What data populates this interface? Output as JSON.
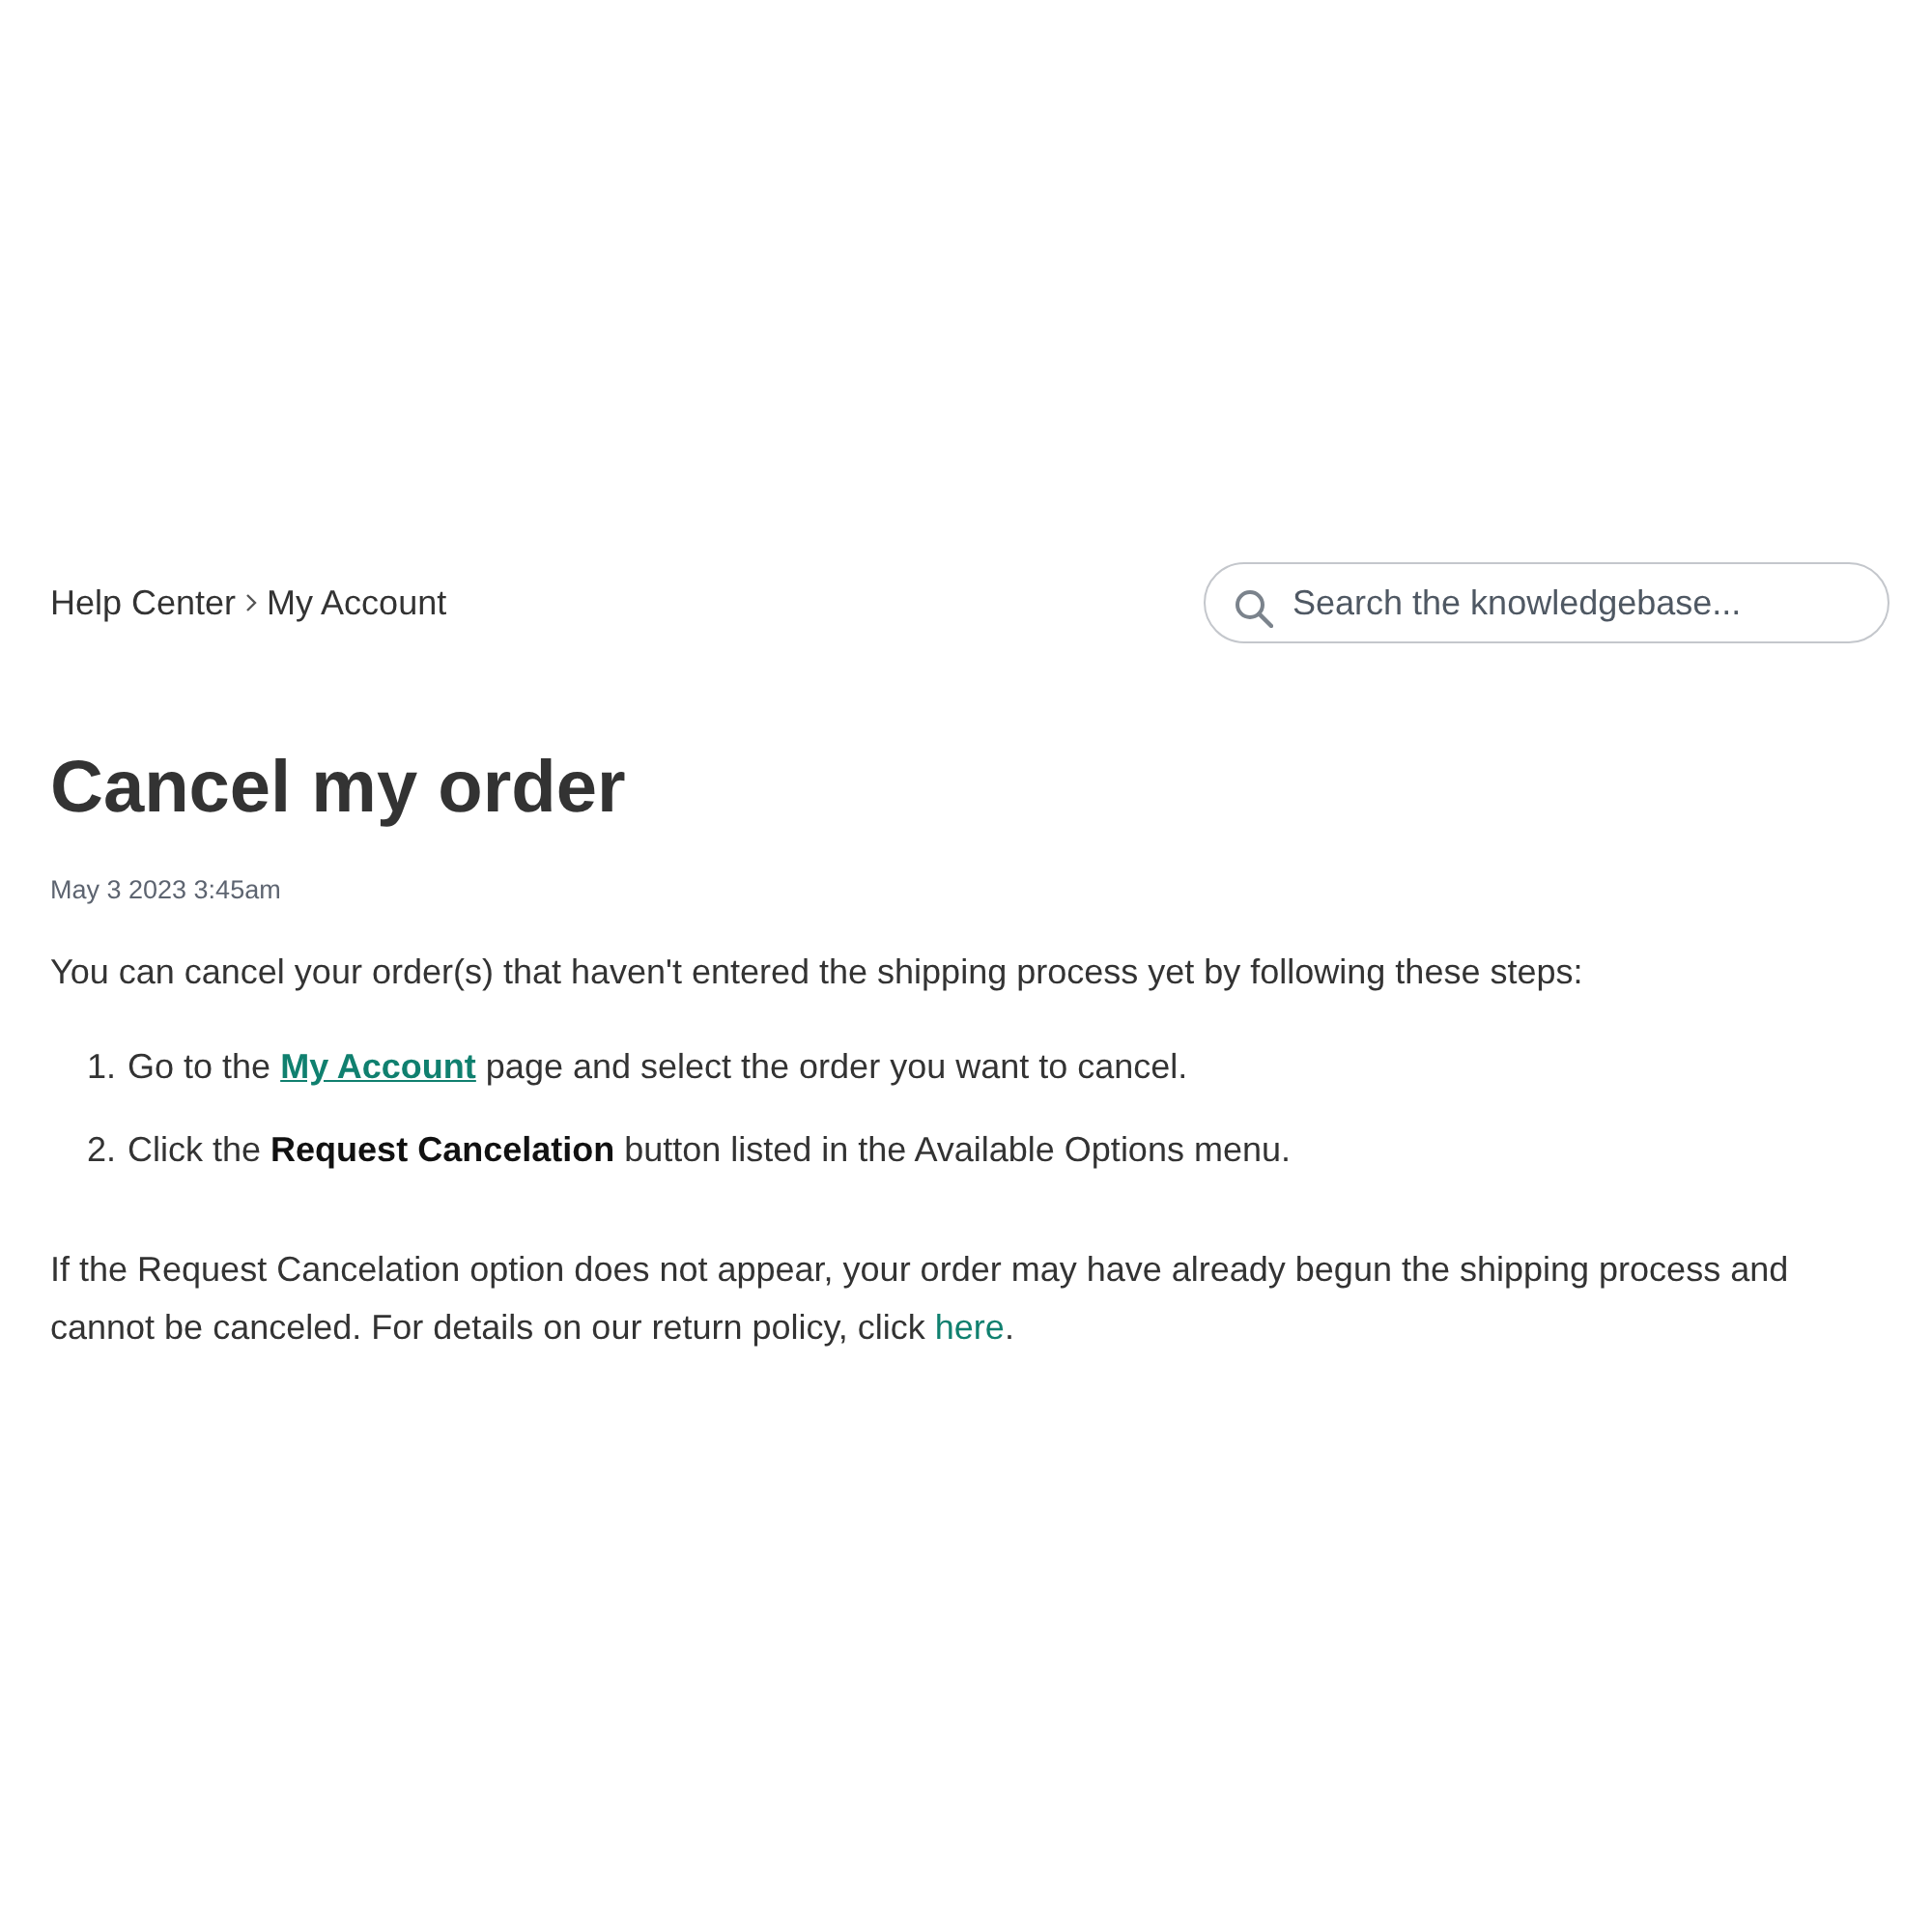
{
  "breadcrumb": [
    {
      "label": "Help Center"
    },
    {
      "label": "My Account"
    }
  ],
  "search": {
    "placeholder": "Search the knowledgebase..."
  },
  "article": {
    "title": "Cancel my order",
    "date": "May 3 2023 3:45am",
    "intro": "You can cancel your order(s) that haven't entered the shipping process yet by following these steps:",
    "steps": [
      {
        "number": "1.",
        "parts": [
          {
            "kind": "text",
            "text": "Go to the "
          },
          {
            "kind": "link",
            "text": "My Account"
          },
          {
            "kind": "text",
            "text": " page and select the order you want to cancel."
          }
        ]
      },
      {
        "number": "2.",
        "parts": [
          {
            "kind": "text",
            "text": "Click the **Request Cancelation** button listed in the Available Options menu."
          }
        ]
      }
    ],
    "note": [
      {
        "kind": "text",
        "text": "If the Request Cancelation option does not appear, your order may have already begun the shipping process and cannot be canceled. For details on our return policy, click "
      },
      {
        "kind": "plain-link",
        "text": "here"
      },
      {
        "kind": "text",
        "text": "."
      }
    ]
  }
}
